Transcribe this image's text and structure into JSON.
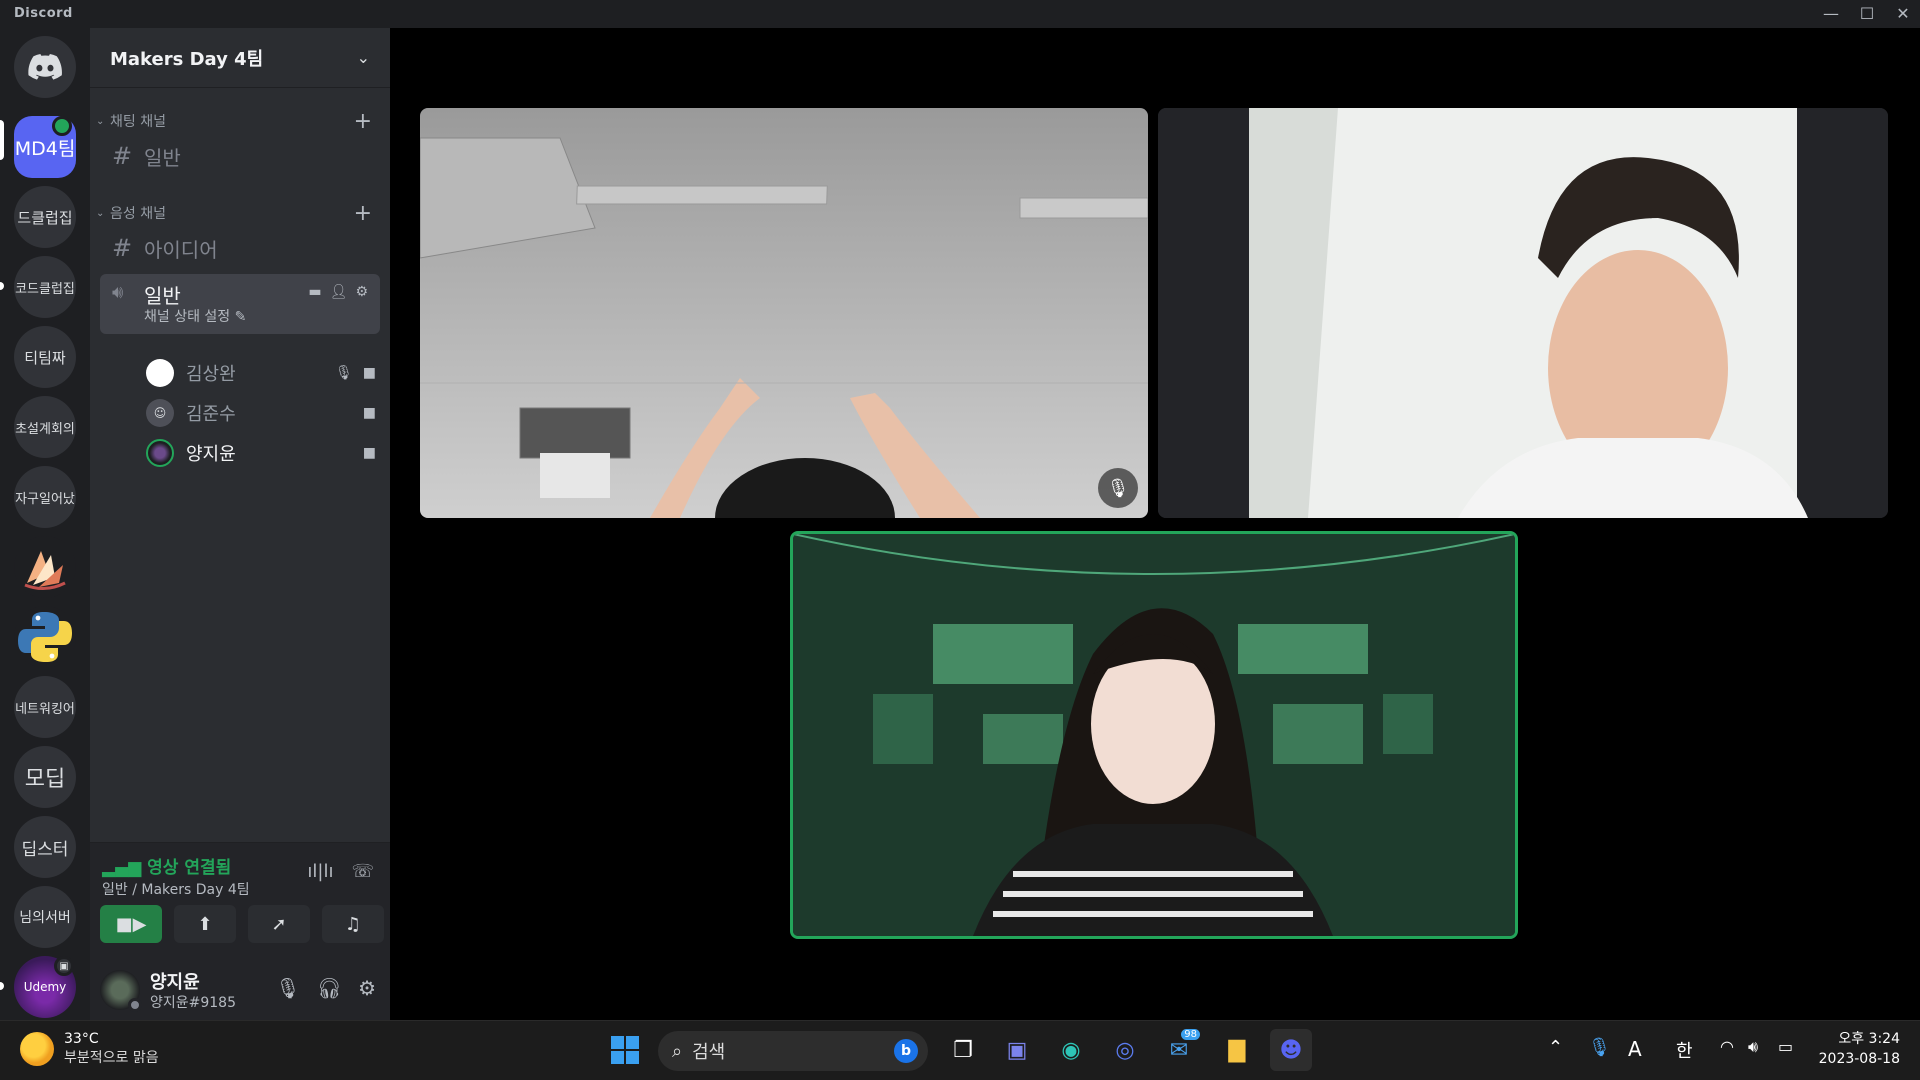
{
  "app": {
    "title": "Discord"
  },
  "server": {
    "name": "Makers Day 4팀"
  },
  "guilds": [
    {
      "label": "MD4팀",
      "active": true
    },
    {
      "label": "드클럽집"
    },
    {
      "label": "코드클럽집"
    },
    {
      "label": "티팀짜"
    },
    {
      "label": "초설계회의"
    },
    {
      "label": "자구일어났"
    },
    {
      "label": ""
    },
    {
      "label": ""
    },
    {
      "label": "네트워킹어"
    },
    {
      "label": "모딥"
    },
    {
      "label": "딥스터"
    },
    {
      "label": "님의서버"
    },
    {
      "label": "Udemy"
    }
  ],
  "categories": {
    "text": {
      "label": "채팅 채널",
      "channels": [
        {
          "name": "일반"
        }
      ]
    },
    "voice": {
      "label": "음성 채널",
      "channels": [
        {
          "name": "아이디어"
        },
        {
          "name": "일반",
          "status": "채널 상태 설정"
        }
      ]
    }
  },
  "voice_users": [
    {
      "name": "김상완",
      "muted": true,
      "video": true
    },
    {
      "name": "김준수",
      "video": true
    },
    {
      "name": "양지윤",
      "video": true
    }
  ],
  "voice_panel": {
    "status": "영상 연결됨",
    "sub": "일반 / Makers Day 4팀"
  },
  "user": {
    "name": "양지윤",
    "tag": "양지윤#9185"
  },
  "taskbar": {
    "weather_temp": "33°C",
    "weather_desc": "부분적으로 맑음",
    "search_placeholder": "검색",
    "mail_badge": "98",
    "ime_a": "A",
    "ime_han": "한",
    "time": "오후 3:24",
    "date": "2023-08-18"
  },
  "colors": {
    "blurple": "#5865f2",
    "green": "#23a55a",
    "sidebar": "#2b2d31",
    "guild_bar": "#1e1f22"
  }
}
